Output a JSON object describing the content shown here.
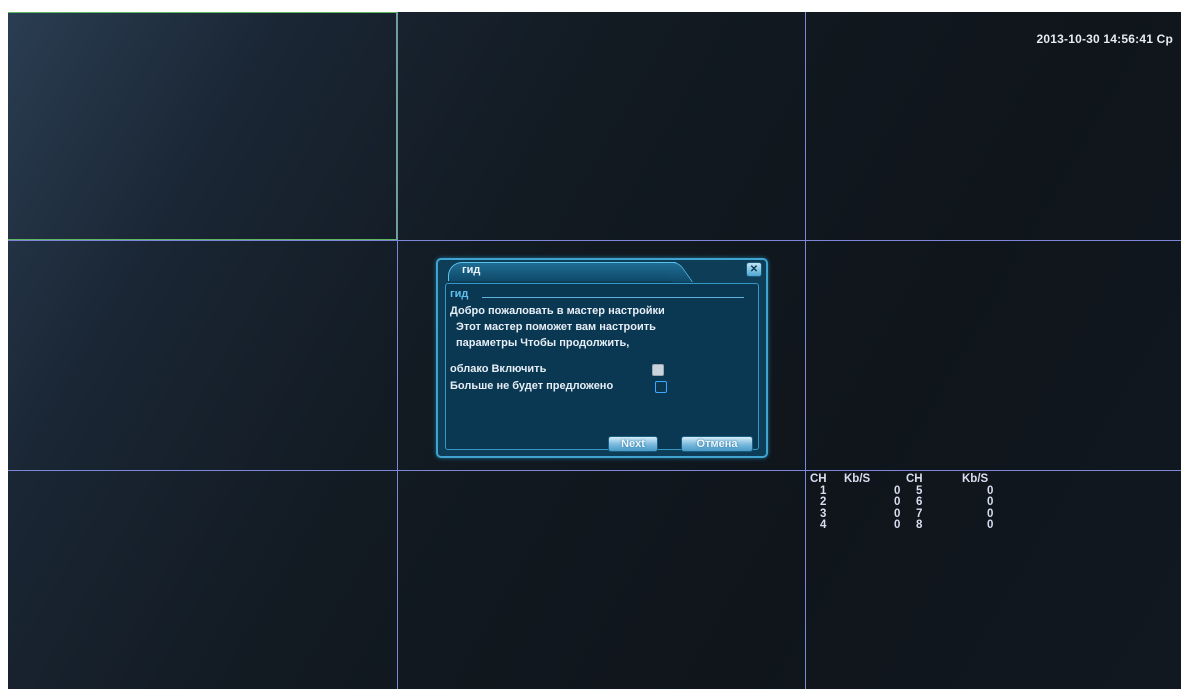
{
  "screen": {
    "clock": "2013-10-30 14:56:41 Ср"
  },
  "bitrate_table": {
    "headers": [
      "CH",
      "Kb/S",
      "CH",
      "Kb/S"
    ],
    "rows": [
      [
        "1",
        "0",
        "5",
        "0"
      ],
      [
        "2",
        "0",
        "6",
        "0"
      ],
      [
        "3",
        "0",
        "7",
        "0"
      ],
      [
        "4",
        "0",
        "8",
        "0"
      ]
    ]
  },
  "dialog": {
    "title": "гид",
    "section_title": "гид",
    "welcome": "Добро пожаловать в мастер настройки",
    "line2": "Этот мастер поможет вам настроить",
    "line3": "параметры Чтобы продолжить,",
    "cloud_label": "облако Включить",
    "cloud_checked": true,
    "no_more_label": "Больше не будет предложено",
    "no_more_checked": false,
    "next_button": "Next",
    "cancel_button": "Отмена",
    "close_icon": "close-icon"
  },
  "colors": {
    "grid_line": "#7d86d8",
    "dialog_border": "#3fa4cf",
    "dialog_bg": "#0d3d57",
    "text": "#e7eef6"
  }
}
